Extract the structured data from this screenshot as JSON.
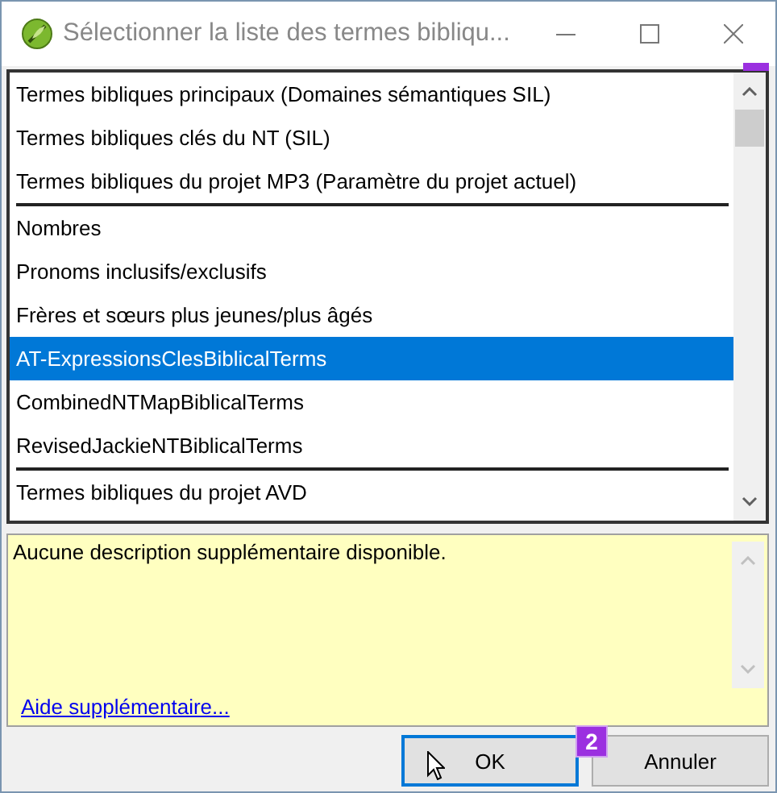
{
  "window": {
    "title": "Sélectionner la liste des termes bibliqu..."
  },
  "list": {
    "groups": [
      {
        "items": [
          {
            "label": "Termes bibliques principaux (Domaines sémantiques SIL)",
            "selected": false
          },
          {
            "label": "Termes bibliques clés du NT (SIL)",
            "selected": false
          },
          {
            "label": "Termes bibliques du projet MP3 (Paramètre du projet actuel)",
            "selected": false
          }
        ]
      },
      {
        "items": [
          {
            "label": "Nombres",
            "selected": false
          },
          {
            "label": "Pronoms inclusifs/exclusifs",
            "selected": false
          },
          {
            "label": "Frères et sœurs plus jeunes/plus âgés",
            "selected": false
          },
          {
            "label": "AT-ExpressionsClesBiblicalTerms",
            "selected": true
          },
          {
            "label": "CombinedNTMapBiblicalTerms",
            "selected": false
          },
          {
            "label": "RevisedJackieNTBiblicalTerms",
            "selected": false
          }
        ]
      },
      {
        "items": [
          {
            "label": "Termes bibliques du projet AVD",
            "selected": false
          }
        ]
      }
    ]
  },
  "description": {
    "text": "Aucune description supplémentaire disponible.",
    "link": "Aide supplémentaire..."
  },
  "buttons": [
    {
      "label": "OK",
      "focused": true,
      "badge": "2"
    },
    {
      "label": "Annuler",
      "focused": false
    }
  ]
}
